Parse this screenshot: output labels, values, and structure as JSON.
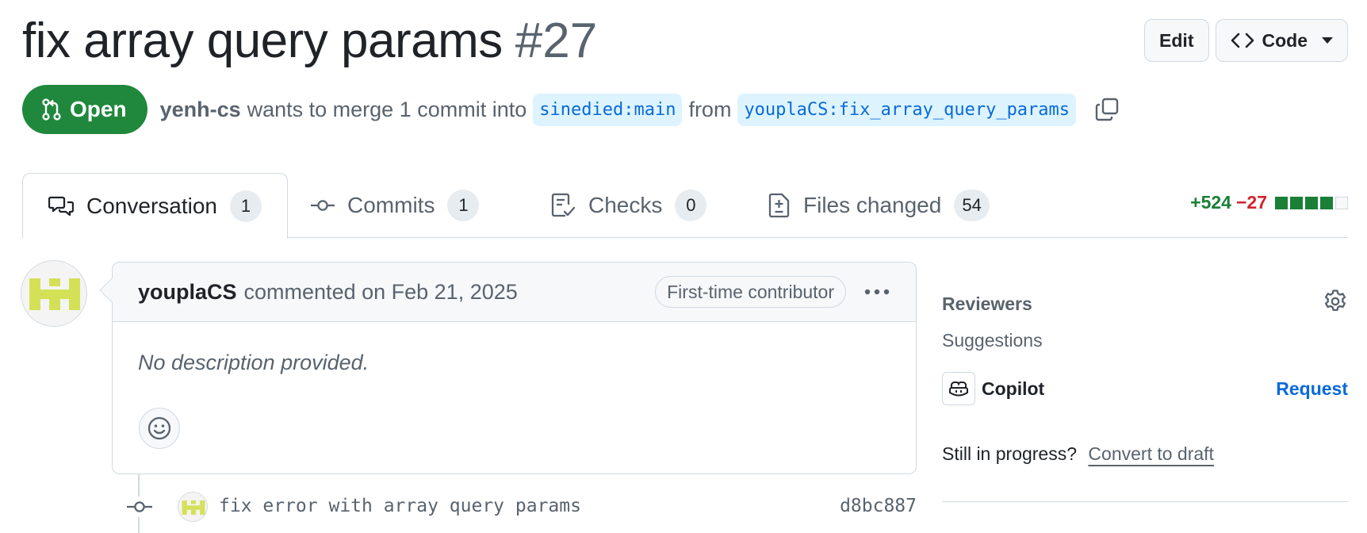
{
  "pr": {
    "title": "fix array query params",
    "number": "#27",
    "state": "Open",
    "author": "yenh-cs",
    "merge_text": "wants to merge 1 commit into",
    "base_branch": "sinedied:main",
    "from_text": "from",
    "head_branch": "youplaCS:fix_array_query_params"
  },
  "header_actions": {
    "edit_label": "Edit",
    "code_label": "Code"
  },
  "tabs": [
    {
      "label": "Conversation",
      "count": "1",
      "icon": "comment-discussion-icon"
    },
    {
      "label": "Commits",
      "count": "1",
      "icon": "git-commit-icon"
    },
    {
      "label": "Checks",
      "count": "0",
      "icon": "checklist-icon"
    },
    {
      "label": "Files changed",
      "count": "54",
      "icon": "file-diff-icon"
    }
  ],
  "diffstat": {
    "additions": "+524",
    "deletions": "−27",
    "blocks_green": 4,
    "blocks_neutral": 1
  },
  "comment": {
    "author": "youplaCS",
    "date_text": "commented on Feb 21, 2025",
    "role_badge": "First-time contributor",
    "body": "No description provided."
  },
  "commit": {
    "message": "fix error with array query params",
    "sha": "d8bc887"
  },
  "sidebar": {
    "reviewers_heading": "Reviewers",
    "suggestions_label": "Suggestions",
    "suggested_reviewer": "Copilot",
    "request_label": "Request",
    "draft_prompt": "Still in progress?",
    "draft_link": "Convert to draft"
  },
  "colors": {
    "open_green": "#1f883d",
    "link_blue": "#0969da",
    "branch_bg": "#ddf4ff",
    "additions": "#1a7f37",
    "deletions": "#d1242f",
    "avatar_identicon": "#d4e157"
  }
}
